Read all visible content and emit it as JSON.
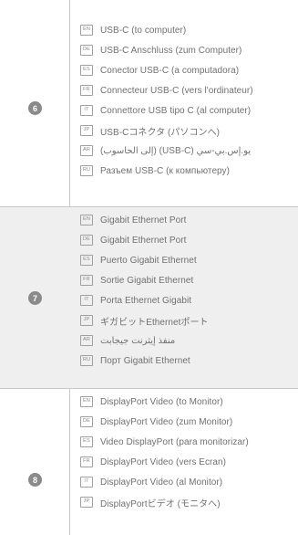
{
  "sections": [
    {
      "number": "6",
      "items": [
        {
          "lang": "EN",
          "text": "USB-C (to computer)"
        },
        {
          "lang": "DE",
          "text": "USB-C Anschluss (zum Computer)"
        },
        {
          "lang": "ES",
          "text": "Conector USB-C (a computadora)"
        },
        {
          "lang": "FR",
          "text": "Connecteur USB-C (vers l'ordinateur)"
        },
        {
          "lang": "IT",
          "text": "Connettore USB tipo C (al computer)"
        },
        {
          "lang": "JP",
          "text": "USB-Cコネクタ (パソコンへ)"
        },
        {
          "lang": "AR",
          "text": "يو.إس.بي-سي (USB-C) (إلى الحاسوب)"
        },
        {
          "lang": "RU",
          "text": "Разъем USB-C (к компьютеру)"
        }
      ]
    },
    {
      "number": "7",
      "items": [
        {
          "lang": "EN",
          "text": "Gigabit Ethernet Port"
        },
        {
          "lang": "DE",
          "text": "Gigabit Ethernet Port"
        },
        {
          "lang": "ES",
          "text": "Puerto Gigabit Ethernet"
        },
        {
          "lang": "FR",
          "text": "Sortie Gigabit Ethernet"
        },
        {
          "lang": "IT",
          "text": "Porta Ethernet Gigabit"
        },
        {
          "lang": "JP",
          "text": "ギガビットEthernetポート"
        },
        {
          "lang": "AR",
          "text": "منفذ إيثرنت جيجابت"
        },
        {
          "lang": "RU",
          "text": "Порт Gigabit Ethernet"
        }
      ]
    },
    {
      "number": "8",
      "items": [
        {
          "lang": "EN",
          "text": "DisplayPort Video (to Monitor)"
        },
        {
          "lang": "DE",
          "text": "DisplayPort Video (zum Monitor)"
        },
        {
          "lang": "ES",
          "text": "Video DisplayPort (para monitorizar)"
        },
        {
          "lang": "FR",
          "text": "DisplayPort Video (vers Ecran)"
        },
        {
          "lang": "IT",
          "text": "DisplayPort Video (al Monitor)"
        },
        {
          "lang": "JP",
          "text": "DisplayPortビデオ (モニタへ)"
        }
      ]
    }
  ]
}
